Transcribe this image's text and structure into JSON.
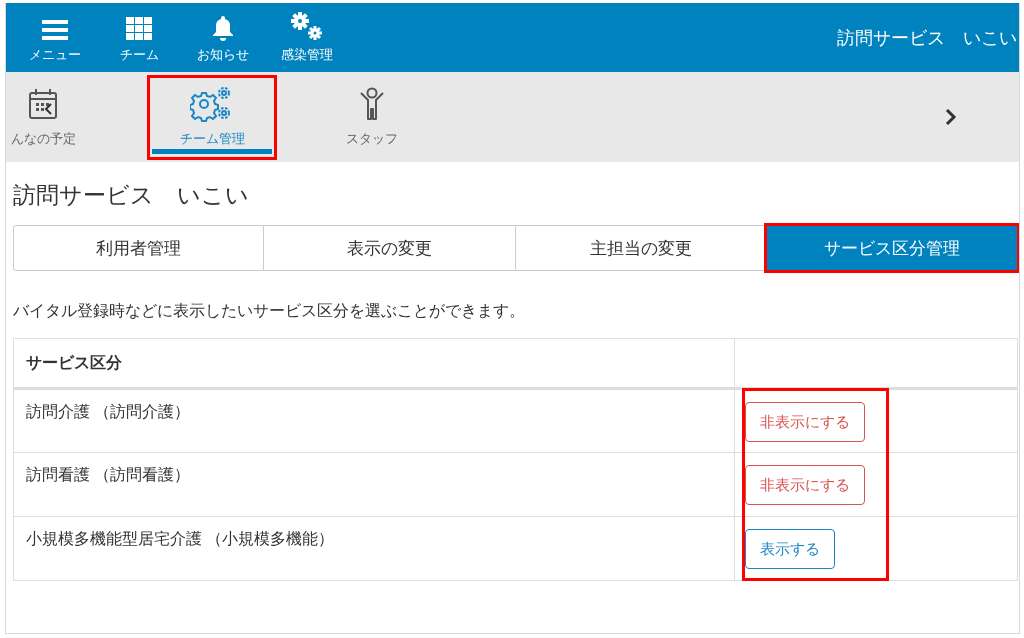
{
  "header": {
    "nav_items": [
      {
        "label": "メニュー",
        "kind": "menu"
      },
      {
        "label": "チーム",
        "kind": "grid"
      },
      {
        "label": "お知らせ",
        "kind": "bell"
      },
      {
        "label": "感染管理",
        "kind": "gears"
      }
    ],
    "title": "訪問サービス　いこい"
  },
  "sub_nav": {
    "items": [
      {
        "label": "んなの予定",
        "kind": "calendar",
        "selected": false,
        "highlighted": false
      },
      {
        "label": "チーム管理",
        "kind": "gears",
        "selected": true,
        "highlighted": true
      },
      {
        "label": "スタッフ",
        "kind": "person",
        "selected": false,
        "highlighted": false
      }
    ]
  },
  "page_title": "訪問サービス　いこい",
  "tabs": [
    {
      "label": "利用者管理",
      "selected": false,
      "highlighted": false
    },
    {
      "label": "表示の変更",
      "selected": false,
      "highlighted": false
    },
    {
      "label": "主担当の変更",
      "selected": false,
      "highlighted": false
    },
    {
      "label": "サービス区分管理",
      "selected": true,
      "highlighted": true
    }
  ],
  "description": "バイタル登録時などに表示したいサービス区分を選ぶことができます。",
  "table": {
    "columns": [
      "サービス区分"
    ],
    "actions_highlighted": true,
    "rows": [
      {
        "service": "訪問介護 （訪問介護）",
        "action": {
          "label": "非表示にする",
          "kind": "hide"
        }
      },
      {
        "service": "訪問看護 （訪問看護）",
        "action": {
          "label": "非表示にする",
          "kind": "hide"
        }
      },
      {
        "service": "小規模多機能型居宅介護 （小規模多機能）",
        "action": {
          "label": "表示する",
          "kind": "show"
        }
      }
    ]
  }
}
